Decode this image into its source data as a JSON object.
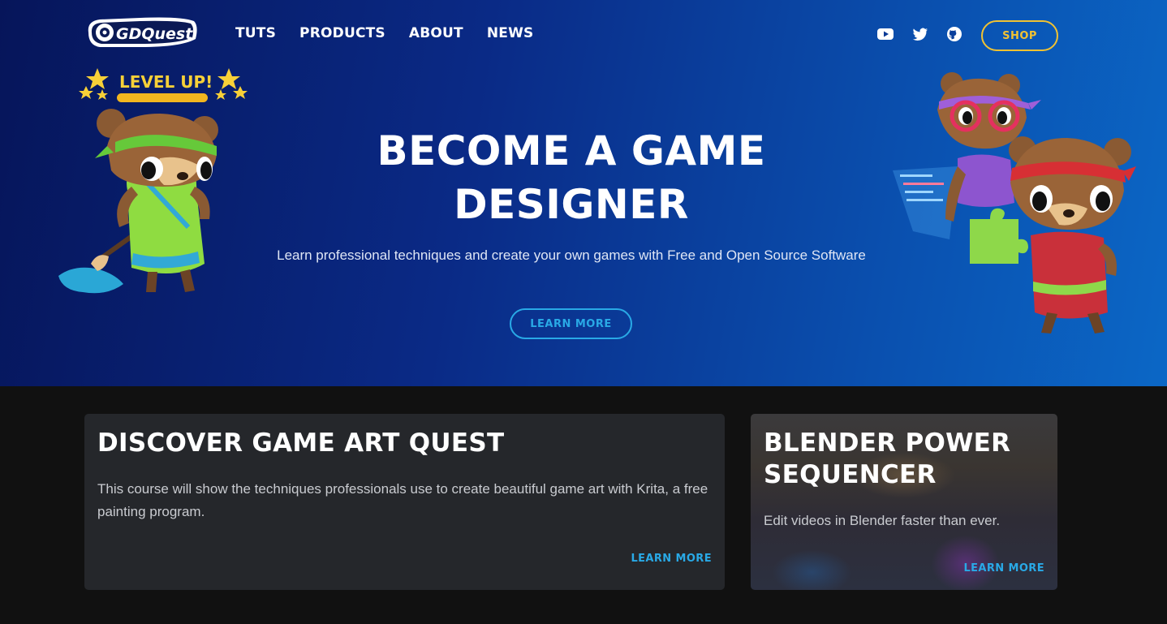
{
  "brand": {
    "logo_text": "GDQuest",
    "colors": {
      "accent_blue": "#29a9e6",
      "accent_yellow": "#f1c232",
      "hero_dark": "#06155a",
      "hero_light": "#0b67c6"
    }
  },
  "nav": {
    "items": [
      {
        "label": "TUTS"
      },
      {
        "label": "PRODUCTS"
      },
      {
        "label": "ABOUT"
      },
      {
        "label": "NEWS"
      }
    ],
    "social": [
      {
        "icon": "youtube-icon"
      },
      {
        "icon": "twitter-icon"
      },
      {
        "icon": "github-icon"
      }
    ],
    "shop_label": "SHOP"
  },
  "hero": {
    "title_line1": "BECOME A GAME",
    "title_line2": "DESIGNER",
    "subtitle": "Learn professional techniques and create your own games with Free and Open Source Software",
    "cta": "LEARN MORE",
    "badge": "LEVEL UP!"
  },
  "cards": [
    {
      "title": "DISCOVER GAME ART QUEST",
      "text": "This course will show the techniques professionals use to create beautiful game art with Krita, a free painting program.",
      "link": "LEARN MORE"
    },
    {
      "title": "BLENDER POWER SEQUENCER",
      "text": "Edit videos in Blender faster than ever.",
      "link": "LEARN MORE"
    }
  ]
}
